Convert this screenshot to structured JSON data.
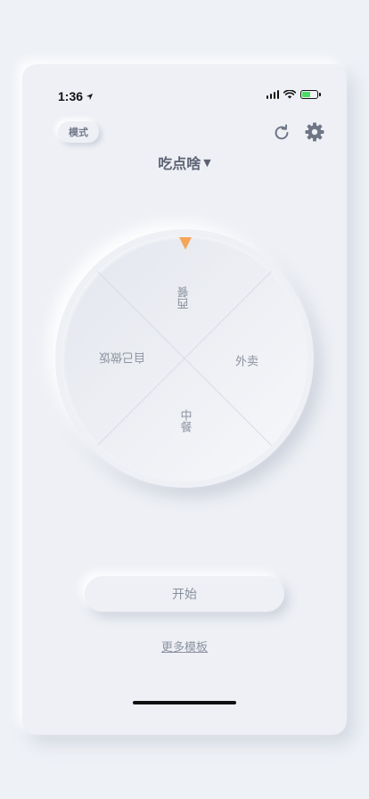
{
  "status_bar": {
    "time": "1:36",
    "icons": [
      "location-arrow-icon",
      "signal-icon",
      "wifi-icon",
      "battery-charging-icon"
    ]
  },
  "header": {
    "mode_label": "模式",
    "title": "吃点啥",
    "title_caret": "▼",
    "icons": [
      "refresh-icon",
      "gear-icon"
    ]
  },
  "wheel": {
    "slices": [
      "西餐",
      "外卖",
      "中餐",
      "自己做饭"
    ],
    "pointer_color": "#f5a55a"
  },
  "actions": {
    "start_label": "开始",
    "more_label": "更多模板"
  },
  "colors": {
    "background": "#eef1f6",
    "text_muted": "#8d93a1",
    "accent": "#f5a55a"
  }
}
